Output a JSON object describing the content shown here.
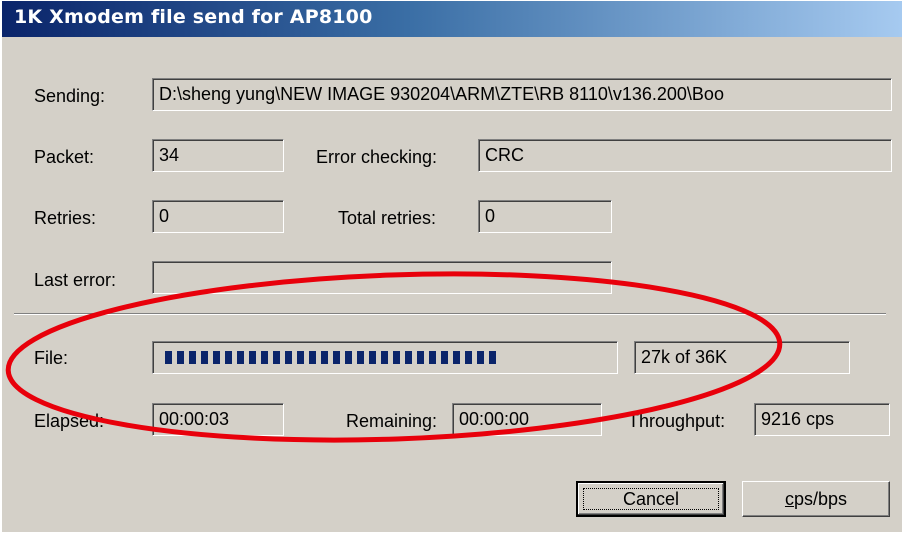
{
  "window": {
    "title": "1K Xmodem file send for AP8100"
  },
  "labels": {
    "sending": "Sending:",
    "packet": "Packet:",
    "error_checking": "Error checking:",
    "retries": "Retries:",
    "total_retries": "Total retries:",
    "last_error": "Last error:",
    "file": "File:",
    "elapsed": "Elapsed:",
    "remaining": "Remaining:",
    "throughput": "Throughput:"
  },
  "values": {
    "sending": "D:\\sheng yung\\NEW IMAGE 930204\\ARM\\ZTE\\RB 8110\\v136.200\\Boo",
    "packet": "34",
    "error_checking": "CRC",
    "retries": "0",
    "total_retries": "0",
    "last_error": "",
    "file_progress_text": "27k of 36K",
    "file_progress_fraction": 0.75,
    "elapsed": "00:00:03",
    "remaining": "00:00:00",
    "throughput": "9216 cps"
  },
  "buttons": {
    "cancel": "Cancel",
    "cps_bps": "cps/bps"
  },
  "colors": {
    "annotation": "#e8000b",
    "titlebar_start": "#0a246a",
    "progress_fill": "#0a246a",
    "dialog_face": "#d4d0c8"
  }
}
